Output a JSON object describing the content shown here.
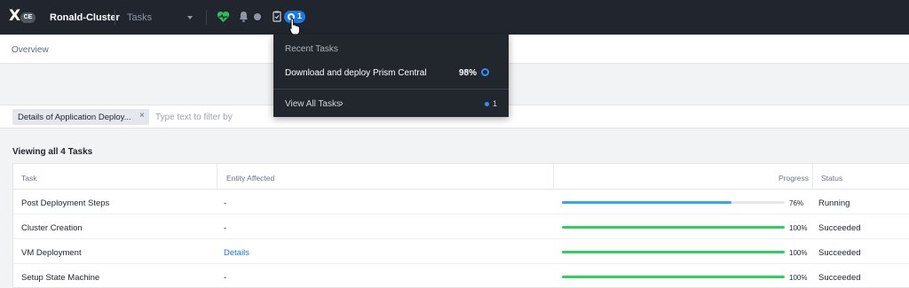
{
  "topbar": {
    "cluster_name": "Ronald-Cluster",
    "nav_select": "Tasks",
    "logo_badge": "CE",
    "task_count": "1",
    "health_color": "#2ebd59",
    "accent": "#1b7ae0"
  },
  "overview": {
    "label": "Overview"
  },
  "filter": {
    "chip_label": "Details of Application Deploy...",
    "chip_remove": "×",
    "placeholder": "Type text to filter by"
  },
  "viewing_label": "Viewing all 4 Tasks",
  "table": {
    "columns": [
      "Task",
      "Entity Affected",
      "Progress",
      "Status"
    ],
    "rows": [
      {
        "task": "Post Deployment Steps",
        "entity": "-",
        "progress": 0.76,
        "progress_label": "76%",
        "status": "Running",
        "bar_color": "#35a8ea"
      },
      {
        "task": "Cluster Creation",
        "entity": "-",
        "progress": 1.0,
        "progress_label": "100%",
        "status": "Succeeded",
        "bar_color": "#2dd25a"
      },
      {
        "task": "VM Deployment",
        "entity": "Details",
        "progress": 1.0,
        "progress_label": "100%",
        "status": "Succeeded",
        "bar_color": "#2dd25a"
      },
      {
        "task": "Setup State Machine",
        "entity": "-",
        "progress": 1.0,
        "progress_label": "100%",
        "status": "Succeeded",
        "bar_color": "#2dd25a"
      }
    ]
  },
  "dropdown": {
    "title": "Recent Tasks",
    "task_name": "Download and deploy Prism Central",
    "task_pct": "98%",
    "view_all": "View All Tasks",
    "view_all_count": "1"
  }
}
